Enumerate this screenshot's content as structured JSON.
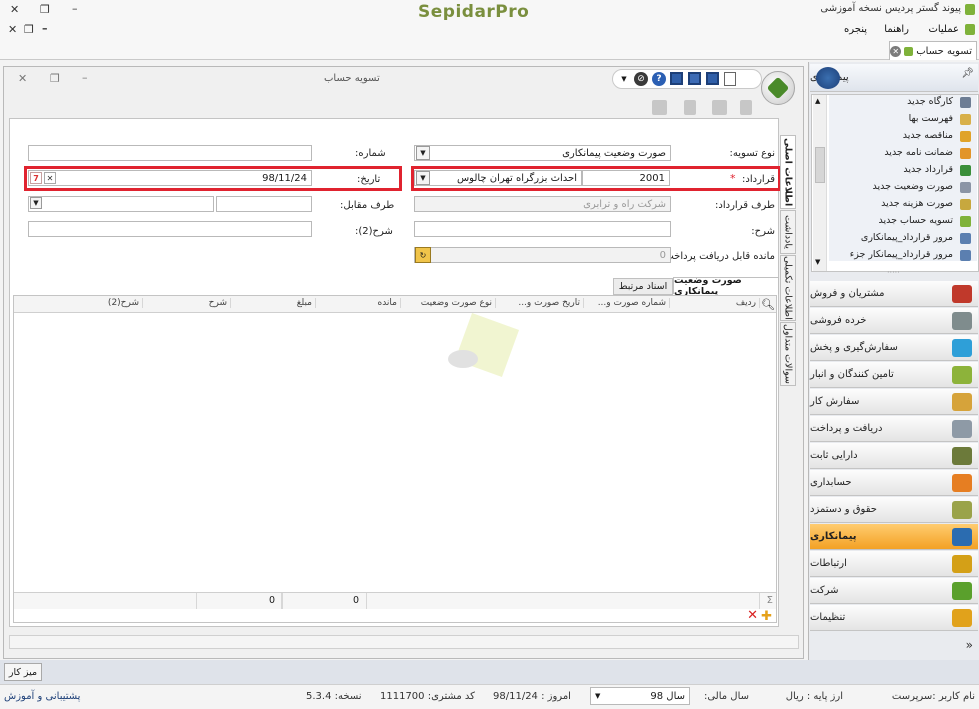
{
  "app": {
    "title": "پیوند گستر پردیس نسخه آموزشی",
    "logo": "SepidarPro"
  },
  "menu": [
    "عملیات",
    "راهنما",
    "پنجره"
  ],
  "doc_tab": {
    "label": "تسویه حساب"
  },
  "window": {
    "title": "تسویه حساب"
  },
  "form": {
    "settlement_type_label": "نوع تسویه:",
    "settlement_type_value": "صورت وضعیت پیمانکاری",
    "number_label": "شماره:",
    "number_value": "",
    "contract_label": "قرارداد:",
    "contract_required": "*",
    "contract_code": "2001",
    "contract_name": "احداث بزرگراه تهران چالوس",
    "date_label": "تاریخ:",
    "date_value": "98/11/24",
    "contract_party_label": "طرف قرارداد:",
    "contract_party_value": "شرکت راه و ترابری",
    "counterparty_label": "طرف مقابل:",
    "description_label": "شرح:",
    "description2_label": "شرح(2):",
    "remaining_label": "مانده قابل دریافت پرداخت:",
    "remaining_value": "0"
  },
  "side_tabs": [
    "اطلاعات اصلی",
    "یادداشت",
    "اطلاعات تکمیلی",
    "سوالات متداول"
  ],
  "grid_tabs": [
    "صورت وضعیت پیمانکاری",
    "اسناد مرتبط"
  ],
  "grid": {
    "columns": [
      "ردیف",
      "شماره صورت و...",
      "تاریخ صورت و...",
      "نوع صورت وضعیت",
      "مانده",
      "مبلغ",
      "شرح",
      "شرح(2)"
    ],
    "totals": {
      "remaining": "0",
      "amount": "0"
    },
    "sigma": "Σ"
  },
  "right_panel": {
    "header": "پیمانکاری",
    "sub_items": [
      "کارگاه جدید",
      "فهرست بها",
      "مناقصه جدید",
      "ضمانت نامه جدید",
      "قرارداد جدید",
      "صورت وضعیت جدید",
      "صورت هزینه جدید",
      "تسویه حساب جدید",
      "مرور قرارداد_پیمانکاری",
      "مرور قرارداد_پیمانکار جزء"
    ],
    "modules": [
      {
        "label": "مشتریان و فروش",
        "color": "#c0392b"
      },
      {
        "label": "خرده فروشی",
        "color": "#7f8c8d"
      },
      {
        "label": "سفارش‌گیری و پخش",
        "color": "#2e9fd8"
      },
      {
        "label": "تامین کنندگان و انبار",
        "color": "#8db33a"
      },
      {
        "label": "سفارش کار",
        "color": "#d6a33a"
      },
      {
        "label": "دریافت و پرداخت",
        "color": "#8e9aa6"
      },
      {
        "label": "دارایی ثابت",
        "color": "#6c7a3a"
      },
      {
        "label": "حسابداری",
        "color": "#e67e22"
      },
      {
        "label": "حقوق و دستمزد",
        "color": "#9aa34a"
      },
      {
        "label": "پیمانکاری",
        "color": "#2b6cb0",
        "active": true
      },
      {
        "label": "ارتباطات",
        "color": "#d4a017"
      },
      {
        "label": "شرکت",
        "color": "#5aa02c"
      },
      {
        "label": "تنظیمات",
        "color": "#e1a21b"
      }
    ]
  },
  "desk": {
    "label": "میز کار"
  },
  "status": {
    "user": "نام کاربر :سرپرست",
    "base_currency": "ارز پایه : ریال",
    "fiscal_year_label": "سال مالی:",
    "fiscal_year_value": "سال 98",
    "today": "امروز : 98/11/24",
    "customer_code": "کد مشتری: 1111700",
    "version": "نسخه: 5.3.4",
    "support": "پشتیبانی و آموزش"
  },
  "colors": {
    "highlight": "#e0232f",
    "active_module": "#f3a124"
  }
}
